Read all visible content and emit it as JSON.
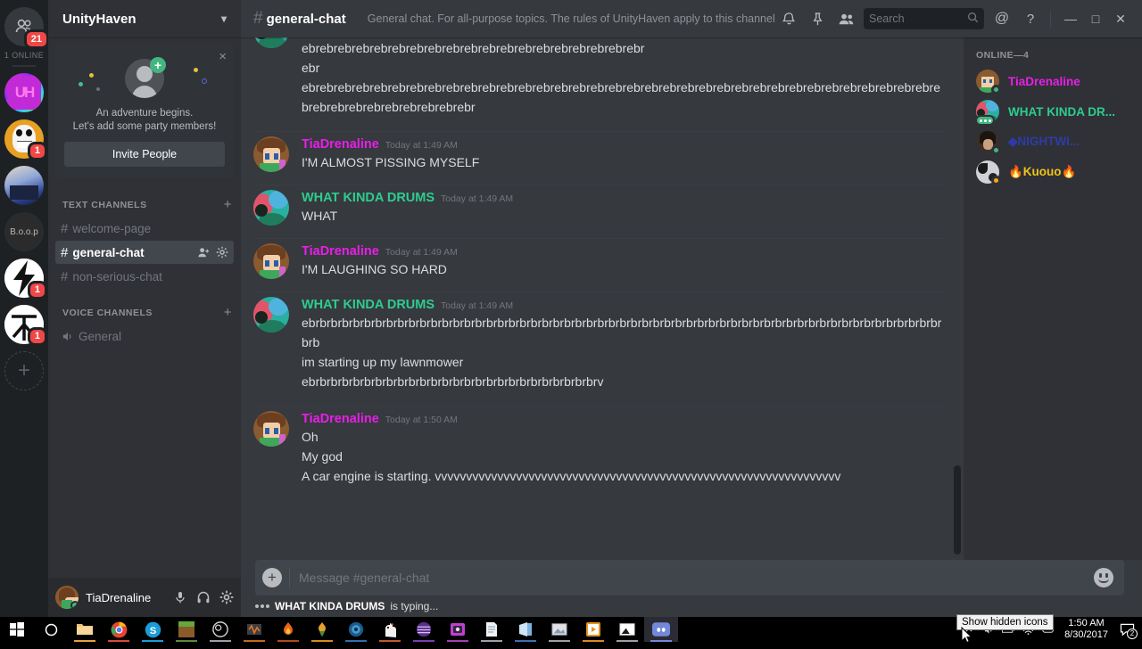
{
  "guild_rail": {
    "friends_icon": "friends-icon",
    "friends_badge": "21",
    "online_label": "1 ONLINE",
    "servers": [
      {
        "name": "unityhaven-server",
        "initials": "UH",
        "badge": ""
      },
      {
        "name": "skull-server",
        "initials": "",
        "badge": "1"
      },
      {
        "name": "night-server",
        "initials": "",
        "badge": ""
      },
      {
        "name": "boop-server",
        "initials": "B.o.o.p",
        "badge": ""
      },
      {
        "name": "bolt-server",
        "initials": "",
        "badge": "1"
      },
      {
        "name": "tree-server",
        "initials": "",
        "badge": "1"
      }
    ],
    "add_server_label": "+"
  },
  "sidebar": {
    "guild_name": "UnityHaven",
    "chevron": "▾",
    "invite_card": {
      "close": "×",
      "line1": "An adventure begins.",
      "line2": "Let's add some party members!",
      "button": "Invite People"
    },
    "text_category": "TEXT CHANNELS",
    "voice_category": "VOICE CHANNELS",
    "add_channel": "+",
    "text_channels": [
      {
        "name": "welcome-page",
        "active": false
      },
      {
        "name": "general-chat",
        "active": true
      },
      {
        "name": "non-serious-chat",
        "active": false
      }
    ],
    "voice_channels": [
      {
        "name": "General"
      }
    ]
  },
  "user_panel": {
    "username": "TiaDrenaline",
    "mute_icon": "microphone-icon",
    "deafen_icon": "headphones-icon",
    "settings_icon": "gear-icon"
  },
  "header": {
    "hash": "#",
    "channel": "general-chat",
    "topic": "General chat. For all-purpose topics. The rules of UnityHaven apply to this channel. This m...",
    "icons": [
      "bell-icon",
      "pin-icon",
      "members-icon"
    ],
    "search_placeholder": "Search",
    "mentions_icon": "@",
    "help_icon": "?",
    "minimize": "—",
    "maximize": "□",
    "close": "✕"
  },
  "messages": [
    {
      "id": "partial-wkd",
      "partial": true,
      "author": "WHAT KINDA DRUMS",
      "color": "#2ecc8f",
      "lines": [
        "ebrebrebrebrebrebrebrebrebrebrebrebrebrebrebrebrebrebrebr",
        "ebr",
        "ebrebrebrebrebrebrebrebrebrebrebrebrebrebrebrebrebrebrebrebrebrebrebrebrebrebrebrebrebrebrebrebrebrebrebrebrebrebrebrebrebrebrebrebrebr"
      ]
    },
    {
      "id": "msg-tia-1",
      "partial": false,
      "author": "TiaDrenaline",
      "color": "#e91ee9",
      "timestamp": "Today at 1:49 AM",
      "avatar": "tia",
      "lines": [
        "I'M ALMOST PISSING MYSELF"
      ]
    },
    {
      "id": "msg-wkd-1",
      "partial": false,
      "author": "WHAT KINDA DRUMS",
      "color": "#2ecc8f",
      "timestamp": "Today at 1:49 AM",
      "avatar": "wkd",
      "lines": [
        "WHAT"
      ]
    },
    {
      "id": "msg-tia-2",
      "partial": false,
      "author": "TiaDrenaline",
      "color": "#e91ee9",
      "timestamp": "Today at 1:49 AM",
      "avatar": "tia",
      "lines": [
        "I'M LAUGHING SO HARD"
      ]
    },
    {
      "id": "msg-wkd-2",
      "partial": false,
      "author": "WHAT KINDA DRUMS",
      "color": "#2ecc8f",
      "timestamp": "Today at 1:49 AM",
      "avatar": "wkd",
      "lines": [
        "ebrbrbrbrbrbrbrbrbrbrbrbrbrbrbrbrbrbrbrbrbrbrbrbrbrbrbrbrbrbrbrbrbrbrbrbrbrbrbrbrbrbrbrbrbrbrbrbrbrbrbrbrbrbrbrbrbrbrb",
        "im starting up my lawnmower",
        "ebrbrbrbrbrbrbrbrbrbrbrbrbrbrbrbrbrbrbrbrbrbrbrbrbrbrv"
      ]
    },
    {
      "id": "msg-tia-3",
      "partial": false,
      "author": "TiaDrenaline",
      "color": "#e91ee9",
      "timestamp": "Today at 1:50 AM",
      "avatar": "tia",
      "lines": [
        "Oh",
        "My god",
        "A car engine is starting. vvvvvvvvvvvvvvvvvvvvvvvvvvvvvvvvvvvvvvvvvvvvvvvvvvvvvvvvvvvvvvvvv"
      ]
    }
  ],
  "members": {
    "category": "ONLINE—4",
    "list": [
      {
        "name": "TiaDrenaline",
        "color": "#e91ee9",
        "status": "online",
        "avatar": "tia",
        "typing": false
      },
      {
        "name": "WHAT KINDA DR...",
        "color": "#2ecc8f",
        "status": "online",
        "avatar": "wkd",
        "typing": true
      },
      {
        "name": "◆NIGHTWI...",
        "color": "#2f3aa8",
        "status": "online",
        "avatar": "night",
        "typing": false
      },
      {
        "name": "🔥Kuouo🔥",
        "color": "#f0c419",
        "status": "idle",
        "avatar": "kuouo",
        "typing": false
      }
    ]
  },
  "composer": {
    "plus": "+",
    "placeholder": "Message #general-chat",
    "emoji_icon": "emoji-icon"
  },
  "typing_indicator": {
    "name": "WHAT KINDA DRUMS",
    "rest": "is typing..."
  },
  "taskbar": {
    "start": "start-icon",
    "cortana": "cortana-icon",
    "apps": [
      {
        "name": "file-explorer",
        "underline": "#e8a13a"
      },
      {
        "name": "google-chrome",
        "underline": "#d8493f"
      },
      {
        "name": "skype",
        "underline": "#1b9cd8"
      },
      {
        "name": "minecraft",
        "underline": "#5b8a3c"
      },
      {
        "name": "obs-studio",
        "underline": "#9aa0a6"
      },
      {
        "name": "audio-editor",
        "underline": "#c06a1e"
      },
      {
        "name": "firealpaca",
        "underline": "#b04a1e"
      },
      {
        "name": "fl-studio",
        "underline": "#d88a1e"
      },
      {
        "name": "blue-app",
        "underline": "#2f6fb0"
      },
      {
        "name": "alpaca-app",
        "underline": "#c05a2e"
      },
      {
        "name": "purple-app",
        "underline": "#7a3fb0"
      },
      {
        "name": "paint-tool",
        "underline": "#a03fb0"
      },
      {
        "name": "notepad",
        "underline": "#9aa0a6"
      },
      {
        "name": "blue-doc",
        "underline": "#3f6fb0"
      },
      {
        "name": "image-viewer",
        "underline": "#9aa0a6"
      },
      {
        "name": "media-player",
        "underline": "#d88a1e"
      },
      {
        "name": "photos",
        "underline": "#9aa0a6"
      },
      {
        "name": "discord",
        "underline": "#7289da"
      }
    ],
    "tooltip": "Show hidden icons",
    "tray_icons": [
      "show-hidden-icons",
      "volume-icon",
      "battery-icon",
      "network-icon",
      "onedrive-icon"
    ],
    "time": "1:50 AM",
    "date": "8/30/2017",
    "action_center_badge": "2"
  }
}
